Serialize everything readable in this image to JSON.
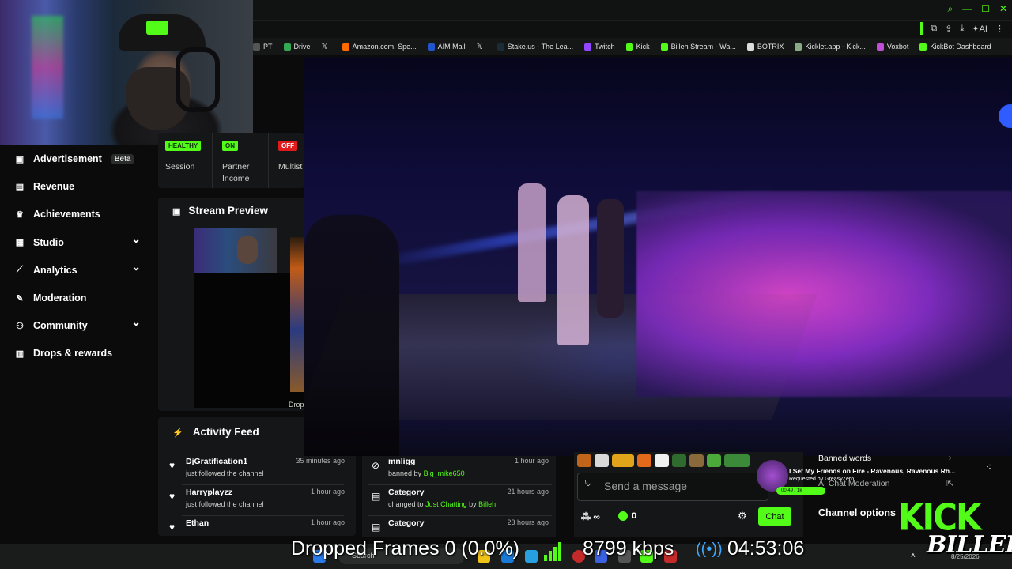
{
  "bookmarks": [
    {
      "label": "PT",
      "color": "#555555"
    },
    {
      "label": "Drive",
      "color": "#34a853"
    },
    {
      "label": "",
      "color": "#000000",
      "icon": "x-icon"
    },
    {
      "label": "Amazon.com. Spe...",
      "color": "#ff6a00"
    },
    {
      "label": "AIM Mail",
      "color": "#2255cc"
    },
    {
      "label": "",
      "color": "#000000",
      "icon": "x-icon"
    },
    {
      "label": "Stake.us - The Lea...",
      "color": "#1a2c38"
    },
    {
      "label": "Twitch",
      "color": "#9146ff"
    },
    {
      "label": "Kick",
      "color": "#53fc18"
    },
    {
      "label": "Billeh Stream - Wa...",
      "color": "#53fc18"
    },
    {
      "label": "BOTRIX",
      "color": "#dddddd"
    },
    {
      "label": "Kicklet.app - Kick...",
      "color": "#88aa88"
    },
    {
      "label": "Voxbot",
      "color": "#c04fd8"
    },
    {
      "label": "KickBot Dashboard",
      "color": "#53fc18"
    }
  ],
  "toolbar": {
    "ai_label": "AI"
  },
  "sidebar": {
    "items": [
      {
        "label": "Advertisement",
        "badge": "Beta",
        "icon": "ad-icon",
        "expandable": false
      },
      {
        "label": "Revenue",
        "icon": "revenue-icon",
        "expandable": false
      },
      {
        "label": "Achievements",
        "icon": "trophy-icon",
        "expandable": false
      },
      {
        "label": "Studio",
        "icon": "studio-icon",
        "expandable": true
      },
      {
        "label": "Analytics",
        "icon": "analytics-icon",
        "expandable": true
      },
      {
        "label": "Moderation",
        "icon": "wrench-icon",
        "expandable": false
      },
      {
        "label": "Community",
        "icon": "community-icon",
        "expandable": true
      },
      {
        "label": "Drops & rewards",
        "icon": "drops-icon",
        "expandable": false
      }
    ]
  },
  "stats": {
    "session": {
      "badge": "HEALTHY",
      "label": "Session"
    },
    "partner": {
      "badge": "ON",
      "label_line1": "Partner",
      "label_line2": "Income"
    },
    "multistream": {
      "badge": "OFF",
      "label": "Multist"
    }
  },
  "preview": {
    "title": "Stream Preview",
    "dropped_mini": "Dropp"
  },
  "activity": {
    "title": "Activity Feed",
    "items": [
      {
        "user": "DjGratification1",
        "action": "just followed the channel",
        "time": "35 minutes ago"
      },
      {
        "user": "Harryplayzz",
        "action": "just followed the channel",
        "time": "1 hour ago"
      },
      {
        "user": "Ethan",
        "action": "",
        "time": "1 hour ago"
      }
    ]
  },
  "mod_feed": {
    "items": [
      {
        "title": "mnligg",
        "prefix": "banned by",
        "actor": "Big_mike650",
        "time": "1 hour ago"
      },
      {
        "title": "Category",
        "prefix": "changed to",
        "target": "Just Chatting",
        "by": "by",
        "actor": "Billeh",
        "time": "21 hours ago"
      },
      {
        "title": "Category",
        "time": "23 hours ago"
      }
    ]
  },
  "chat": {
    "placeholder": "Send a message",
    "infinity": "∞",
    "count": "0",
    "button": "Chat"
  },
  "song": {
    "title": "I Set My Friends on Fire - Ravenous, Ravenous Rh...",
    "requested": "Requested by GreasyZero",
    "progress_label": "00:49 / 1k"
  },
  "mod_panel": {
    "banned_words": "Banned words",
    "ai_moderation": "AI Chat Moderation",
    "channel_options": "Channel options"
  },
  "logo": {
    "kick": "KICK",
    "billeh": "BILLEH"
  },
  "taskbar": {
    "search": "Search",
    "date": "8/25/2026"
  },
  "obs": {
    "dropped": "Dropped Frames 0 (0.0%)",
    "bitrate": "8799 kbps",
    "uptime": "04:53:06"
  },
  "colors": {
    "accent": "#53fc18",
    "danger": "#e01b1b"
  }
}
